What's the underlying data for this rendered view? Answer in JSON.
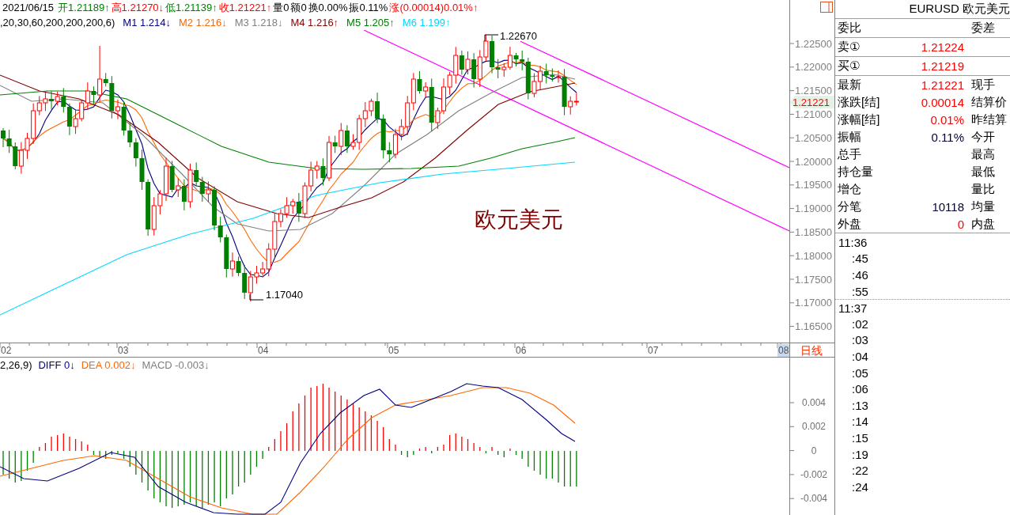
{
  "quote_bar": {
    "date": "2021/06/15",
    "items": [
      {
        "text": "开1.21189↑",
        "color": "#008000"
      },
      {
        "text": "高1.21270↓",
        "color": "#ff0000"
      },
      {
        "text": "低1.21139↑",
        "color": "#008000"
      },
      {
        "text": "收1.21221↑",
        "color": "#ff0000"
      },
      {
        "text": "量0",
        "color": "#000000"
      },
      {
        "text": "额0",
        "color": "#000000"
      },
      {
        "text": "换0.00%",
        "color": "#000000"
      },
      {
        "text": "振0.11%",
        "color": "#000000"
      },
      {
        "text": "涨(0.00014)0.01%↑",
        "color": "#ff0000"
      }
    ]
  },
  "ma_legend": [
    {
      "text": ",20,30,60,200,200,200,6)",
      "color": "#000000"
    },
    {
      "text": "M1 1.214↓",
      "color": "#000080"
    },
    {
      "text": "M2 1.216↓",
      "color": "#ff6600"
    },
    {
      "text": "M3 1.218↓",
      "color": "#808080"
    },
    {
      "text": "M4 1.216↑",
      "color": "#800000"
    },
    {
      "text": "M5 1.205↑",
      "color": "#008000"
    },
    {
      "text": "M6 1.199↑",
      "color": "#00d8ff"
    }
  ],
  "price_chart": {
    "y_axis": [
      "1.22500",
      "1.22000",
      "1.21500",
      "1.21000",
      "1.20500",
      "1.20000",
      "1.19500",
      "1.19000",
      "1.18500",
      "1.18000",
      "1.17500",
      "1.17000",
      "1.16500"
    ],
    "current_price": "1.21221",
    "high_label": "1.22670",
    "low_label": "1.17040",
    "caption": "欧元美元"
  },
  "x_axis": {
    "labels": [
      {
        "text": "02",
        "selected": false
      },
      {
        "text": "03",
        "selected": false
      },
      {
        "text": "04",
        "selected": false
      },
      {
        "text": "05",
        "selected": false
      },
      {
        "text": "06",
        "selected": false
      },
      {
        "text": "07",
        "selected": false
      },
      {
        "text": "08",
        "selected": true
      }
    ],
    "period": "日线"
  },
  "macd": {
    "legend": [
      {
        "text": "2,26,9)",
        "color": "#000000"
      },
      {
        "text": "DIFF 0↓",
        "color": "#000080"
      },
      {
        "text": "DEA 0.002↓",
        "color": "#ff6600"
      },
      {
        "text": "MACD -0.003↓",
        "color": "#808080"
      }
    ],
    "y_axis": [
      "0.004",
      "0.002",
      "0",
      "-0.002",
      "-0.004"
    ]
  },
  "quote_panel": {
    "title": "EURUSD 欧元美元",
    "head": {
      "left": "委比",
      "right": "委差"
    },
    "book": [
      {
        "label": "卖①",
        "value": "1.21224",
        "color": "#ff0000"
      },
      {
        "label": "买①",
        "value": "1.21219",
        "color": "#ff0000"
      }
    ],
    "stats": [
      {
        "label": "最新",
        "value": "1.21221",
        "color": "#ff0000",
        "right_label": "现手"
      },
      {
        "label": "涨跌[结]",
        "value": "0.00014",
        "color": "#ff0000",
        "right_label": "结算价"
      },
      {
        "label": "涨幅[结]",
        "value": "0.01%",
        "color": "#ff0000",
        "right_label": "昨结算"
      },
      {
        "label": "振幅",
        "value": "0.11%",
        "color": "#000033",
        "right_label": "今开"
      },
      {
        "label": "总手",
        "right_label": "最高"
      },
      {
        "label": "持仓量",
        "right_label": "最低"
      },
      {
        "label": "增仓",
        "right_label": "量比"
      },
      {
        "label": "分笔",
        "value": "10118",
        "color": "#000033",
        "right_label": "均量"
      },
      {
        "label": "外盘",
        "value": "0",
        "color": "#ff0000",
        "right_label": "内盘"
      }
    ]
  },
  "tick_times": [
    {
      "time": "11:36",
      "kind": "minute"
    },
    {
      "time": ":45",
      "kind": "second"
    },
    {
      "time": ":46",
      "kind": "second"
    },
    {
      "time": ":55",
      "kind": "second"
    },
    {
      "time": "11:37",
      "kind": "minute"
    },
    {
      "time": ":02",
      "kind": "second"
    },
    {
      "time": ":03",
      "kind": "second"
    },
    {
      "time": ":04",
      "kind": "second"
    },
    {
      "time": ":05",
      "kind": "second"
    },
    {
      "time": ":06",
      "kind": "second"
    },
    {
      "time": ":13",
      "kind": "second"
    },
    {
      "time": ":14",
      "kind": "second"
    },
    {
      "time": ":15",
      "kind": "second"
    },
    {
      "time": ":19",
      "kind": "second"
    },
    {
      "time": ":22",
      "kind": "second"
    },
    {
      "time": ":24",
      "kind": "second"
    }
  ]
}
